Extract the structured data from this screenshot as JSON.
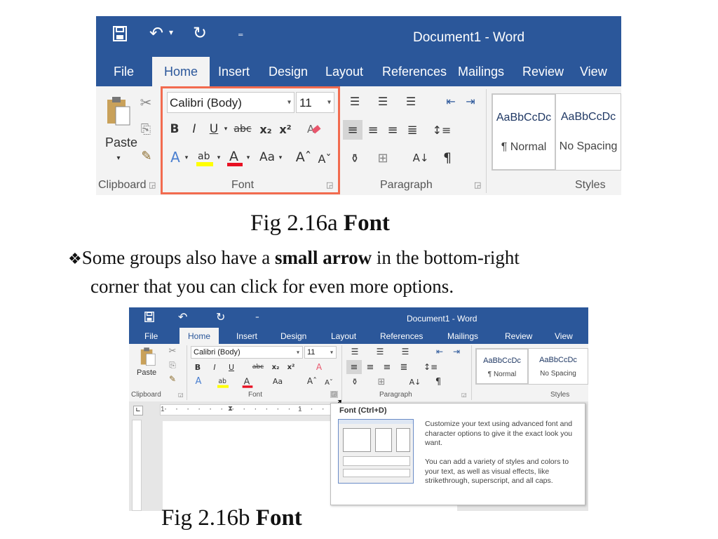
{
  "screenshot_a": {
    "window_title": "Document1 - Word",
    "tabs": [
      "File",
      "Home",
      "Insert",
      "Design",
      "Layout",
      "References",
      "Mailings",
      "Review",
      "View"
    ],
    "active_tab": "Home",
    "clipboard": {
      "paste_label": "Paste",
      "group_label": "Clipboard"
    },
    "font": {
      "family": "Calibri (Body)",
      "size": "11",
      "group_label": "Font"
    },
    "paragraph": {
      "group_label": "Paragraph"
    },
    "styles": {
      "group_label": "Styles",
      "items": [
        {
          "sample": "AaBbCcDc",
          "name": "¶ Normal"
        },
        {
          "sample": "AaBbCcDc",
          "name": "No Spacing"
        }
      ]
    },
    "highlight_color": "#f26b4f"
  },
  "caption_a": {
    "text": "Fig 2.16a ",
    "bold": "Font"
  },
  "bullet": {
    "marker": "❖",
    "before": "Some groups also have a ",
    "bold": "small arrow",
    "after": " in the bottom-right",
    "line2": "corner that you can click for even more options."
  },
  "screenshot_b": {
    "window_title": "Document1 - Word",
    "tabs": [
      "File",
      "Home",
      "Insert",
      "Design",
      "Layout",
      "References",
      "Mailings",
      "Review",
      "View"
    ],
    "clipboard": {
      "paste_label": "Paste",
      "group_label": "Clipboard"
    },
    "font": {
      "family": "Calibri (Body)",
      "size": "11",
      "group_label": "Font"
    },
    "paragraph": {
      "group_label": "Paragraph"
    },
    "styles": {
      "group_label": "Styles",
      "items": [
        {
          "sample": "AaBbCcDc",
          "name": "¶ Normal"
        },
        {
          "sample": "AaBbCcDc",
          "name": "No Spacing"
        }
      ]
    },
    "ruler_marks": [
      "1",
      "1"
    ],
    "tooltip": {
      "title": "Font (Ctrl+D)",
      "para1": "Customize your text using advanced font and character options to give it the exact look you want.",
      "para2": "You can add a variety of styles and colors to your text, as well as visual effects, like strikethrough, superscript, and all caps."
    }
  },
  "caption_b": {
    "text": "Fig 2.16b ",
    "bold": "Font"
  },
  "colors": {
    "word_blue": "#2b579a",
    "font_red": "#e81123",
    "highlight_yellow": "#ffff00"
  }
}
